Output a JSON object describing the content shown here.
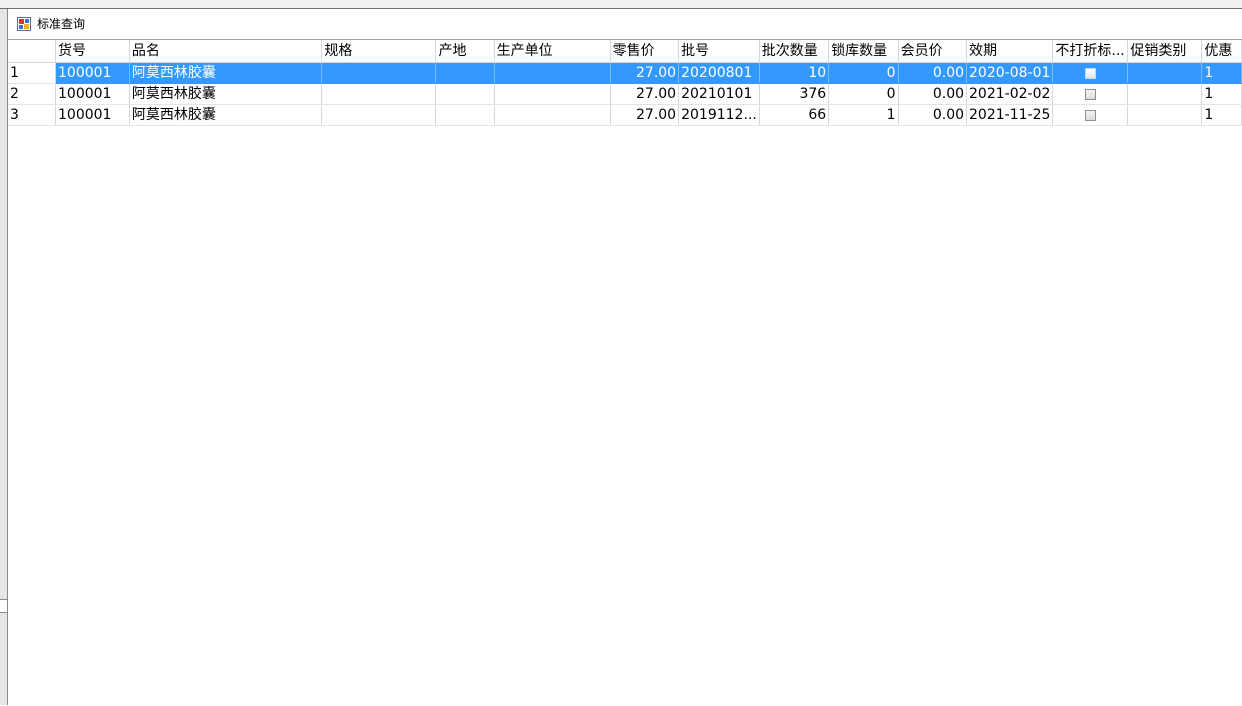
{
  "window": {
    "title": "标准查询"
  },
  "grid": {
    "columns": [
      "",
      "货号",
      "品名",
      "规格",
      "产地",
      "生产单位",
      "零售价",
      "批号",
      "批次数量",
      "锁库数量",
      "会员价",
      "效期",
      "不打折标...",
      "促销类别",
      "优惠"
    ],
    "rows": [
      {
        "row_no": "1",
        "code": "100001",
        "name": "阿莫西林胶囊",
        "spec": "",
        "origin": "",
        "manufacturer": "",
        "retail_price": "27.00",
        "batch_no": "20200801",
        "batch_qty": "10",
        "locked_qty": "0",
        "member_price": "0.00",
        "expiry": "2020-08-01",
        "no_discount": false,
        "promo_type": "",
        "discount": "1",
        "selected": true
      },
      {
        "row_no": "2",
        "code": "100001",
        "name": "阿莫西林胶囊",
        "spec": "",
        "origin": "",
        "manufacturer": "",
        "retail_price": "27.00",
        "batch_no": "20210101",
        "batch_qty": "376",
        "locked_qty": "0",
        "member_price": "0.00",
        "expiry": "2021-02-02",
        "no_discount": false,
        "promo_type": "",
        "discount": "1",
        "selected": false
      },
      {
        "row_no": "3",
        "code": "100001",
        "name": "阿莫西林胶囊",
        "spec": "",
        "origin": "",
        "manufacturer": "",
        "retail_price": "27.00",
        "batch_no": "2019112...",
        "batch_qty": "66",
        "locked_qty": "1",
        "member_price": "0.00",
        "expiry": "2021-11-25",
        "no_discount": false,
        "promo_type": "",
        "discount": "1",
        "selected": false
      }
    ]
  },
  "colors": {
    "selection": "#3399ff",
    "grid_line": "#d8d8d8"
  }
}
